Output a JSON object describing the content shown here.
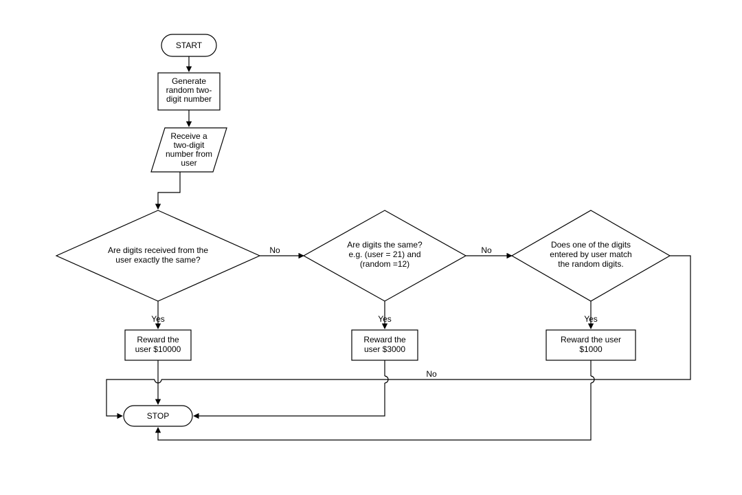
{
  "nodes": {
    "start": "START",
    "generate_l1": "Generate",
    "generate_l2": "random two-",
    "generate_l3": "digit number",
    "receive_l1": "Receive a",
    "receive_l2": "two-digit",
    "receive_l3": "number from",
    "receive_l4": "user",
    "d1_l1": "Are digits received from the",
    "d1_l2": "user exactly the same?",
    "d2_l1": "Are digits the same?",
    "d2_l2": "e.g. (user = 21) and",
    "d2_l3": "(random =12)",
    "d3_l1": "Does one of the digits",
    "d3_l2": "entered by user match",
    "d3_l3": "the random digits.",
    "r1_l1": "Reward the",
    "r1_l2": "user $10000",
    "r2_l1": "Reward the",
    "r2_l2": "user $3000",
    "r3_l1": "Reward the user",
    "r3_l2": "$1000",
    "stop": "STOP"
  },
  "labels": {
    "yes": "Yes",
    "no": "No"
  }
}
